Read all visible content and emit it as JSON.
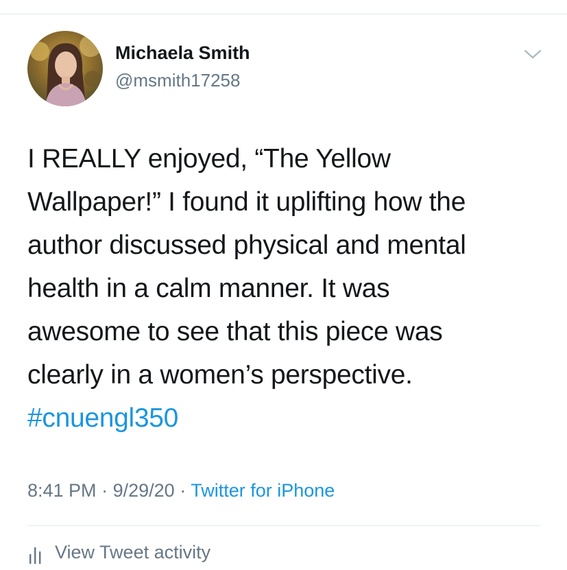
{
  "author": {
    "name": "Michaela Smith",
    "handle": "@msmith17258"
  },
  "icons": {
    "avatar": "profile-photo",
    "menu": "chevron-down-icon",
    "activity": "bar-chart-icon"
  },
  "tweet": {
    "lines": [
      "I REALLY enjoyed, “The Yellow",
      "Wallpaper!” I found it uplifting how the",
      "author discussed physical and mental",
      "health in a calm manner. It was",
      "awesome to see that this piece was",
      "clearly in a women’s perspective."
    ],
    "hashtag": "#cnuengl350"
  },
  "meta": {
    "time": "8:41 PM",
    "separator": "·",
    "date": "9/29/20",
    "source": "Twitter for iPhone"
  },
  "actions": {
    "view_activity": "View Tweet activity"
  },
  "colors": {
    "text": "#14171a",
    "secondary": "#657786",
    "link": "#1b95e0",
    "divider": "#e1e8ed"
  }
}
